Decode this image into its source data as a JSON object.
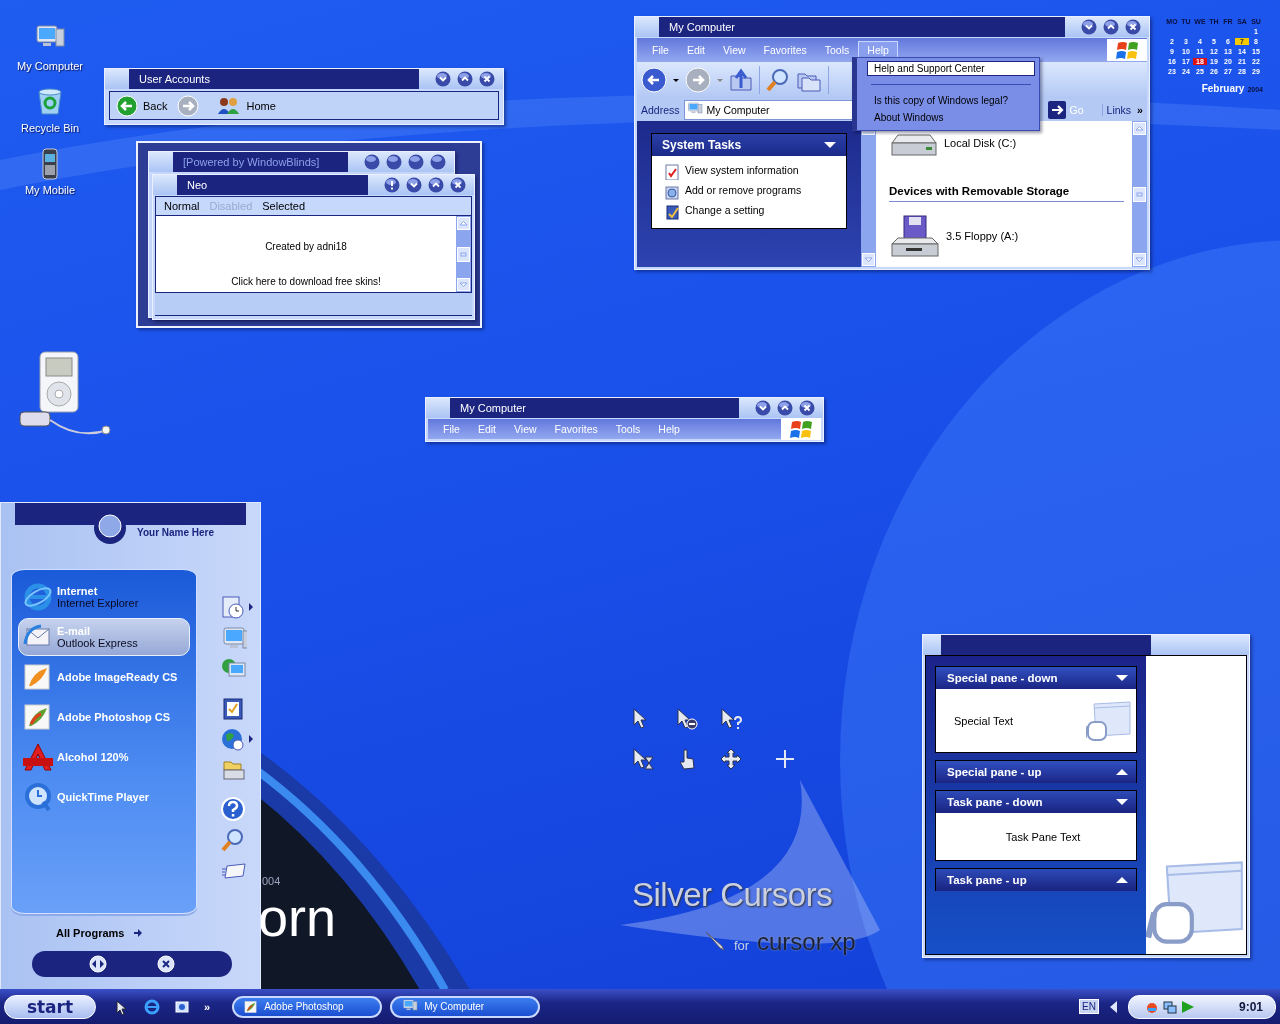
{
  "desktop_icons": [
    {
      "label": "My Computer",
      "kind": "computer"
    },
    {
      "label": "Recycle Bin",
      "kind": "recycle"
    },
    {
      "label": "My Mobile",
      "kind": "phone"
    }
  ],
  "user_accounts": {
    "title": "User Accounts",
    "back": "Back",
    "home": "Home"
  },
  "neo": {
    "back_title": "[Powered by WindowBlinds]",
    "title": "Neo",
    "menu": [
      {
        "label": "Normal",
        "disabled": false
      },
      {
        "label": "Disabled",
        "disabled": true
      },
      {
        "label": "Selected",
        "disabled": false
      }
    ],
    "text": "Created by adni18",
    "link": "Click here to download free skins!"
  },
  "explorer": {
    "title": "My Computer",
    "menu": [
      {
        "label": "File",
        "selected": false
      },
      {
        "label": "Edit",
        "selected": false
      },
      {
        "label": "View",
        "selected": false
      },
      {
        "label": "Favorites",
        "selected": false
      },
      {
        "label": "Tools",
        "selected": false
      },
      {
        "label": "Help",
        "selected": true
      }
    ],
    "address_label": "Address",
    "address": "My Computer",
    "go": "Go",
    "links": "Links",
    "more": "»",
    "tasks_title": "System Tasks",
    "tasks": [
      {
        "label": "View system information",
        "kind": "info"
      },
      {
        "label": "Add or remove programs",
        "kind": "programs"
      },
      {
        "label": "Change a setting",
        "kind": "setting"
      }
    ],
    "drives": [
      {
        "name": "Local Disk (C:)",
        "kind": "disk"
      }
    ],
    "group": "Devices with Removable Storage",
    "removable": [
      {
        "name": "3.5 Floppy (A:)",
        "kind": "floppy"
      }
    ],
    "help_menu": [
      {
        "label": "Help and Support Center",
        "selected": true
      },
      {
        "label": "Is this copy of Windows legal?",
        "selected": false
      },
      {
        "label": "About Windows",
        "selected": false
      }
    ]
  },
  "calendar": {
    "weekdays": [
      "MO",
      "TU",
      "WE",
      "TH",
      "FR",
      "SA",
      "SU"
    ],
    "weeks": [
      [
        {
          "day": "1",
          "selected": false,
          "today": false
        }
      ],
      [
        {
          "day": "2",
          "selected": false,
          "today": false
        },
        {
          "day": "3",
          "selected": false,
          "today": false
        },
        {
          "day": "4",
          "selected": false,
          "today": false
        },
        {
          "day": "5",
          "selected": false,
          "today": false
        },
        {
          "day": "6",
          "selected": false,
          "today": false
        },
        {
          "day": "7",
          "selected": true,
          "today": false
        },
        {
          "day": "8",
          "selected": false,
          "today": false
        }
      ],
      [
        {
          "day": "9",
          "selected": false,
          "today": false
        },
        {
          "day": "10",
          "selected": false,
          "today": false
        },
        {
          "day": "11",
          "selected": false,
          "today": false
        },
        {
          "day": "12",
          "selected": false,
          "today": false
        },
        {
          "day": "13",
          "selected": false,
          "today": false
        },
        {
          "day": "14",
          "selected": false,
          "today": false
        },
        {
          "day": "15",
          "selected": false,
          "today": false
        }
      ],
      [
        {
          "day": "16",
          "selected": false,
          "today": false
        },
        {
          "day": "17",
          "selected": false,
          "today": false
        },
        {
          "day": "18",
          "selected": false,
          "today": true
        },
        {
          "day": "19",
          "selected": false,
          "today": false
        },
        {
          "day": "20",
          "selected": false,
          "today": false
        },
        {
          "day": "21",
          "selected": false,
          "today": false
        },
        {
          "day": "22",
          "selected": false,
          "today": false
        }
      ],
      [
        {
          "day": "23",
          "selected": false,
          "today": false
        },
        {
          "day": "24",
          "selected": false,
          "today": false
        },
        {
          "day": "25",
          "selected": false,
          "today": false
        },
        {
          "day": "26",
          "selected": false,
          "today": false
        },
        {
          "day": "27",
          "selected": false,
          "today": false
        },
        {
          "day": "28",
          "selected": false,
          "today": false
        },
        {
          "day": "29",
          "selected": false,
          "today": false
        }
      ]
    ],
    "month": "February",
    "year": "2004"
  },
  "small_explorer": {
    "title": "My Computer",
    "menu": [
      "File",
      "Edit",
      "View",
      "Favorites",
      "Tools",
      "Help"
    ]
  },
  "wallpaper": {
    "year_fragment": "004",
    "word_fragment": "orn",
    "headline": "Silver Cursors",
    "tag_small": "for",
    "tag": "cursor xp"
  },
  "start_menu": {
    "user": "Your Name Here",
    "programs": [
      {
        "title": "Internet",
        "subtitle": "Internet Explorer",
        "kind": "ie",
        "selected": false
      },
      {
        "title": "E-mail",
        "subtitle": "Outlook Express",
        "kind": "mail",
        "selected": true
      },
      {
        "title": "Adobe ImageReady CS",
        "kind": "imageready",
        "selected": false
      },
      {
        "title": "Adobe Photoshop CS",
        "kind": "photoshop",
        "selected": false
      },
      {
        "title": "Alcohol 120%",
        "kind": "alcohol",
        "selected": false
      },
      {
        "title": "QuickTime Player",
        "kind": "quicktime",
        "selected": false
      }
    ],
    "places": [
      {
        "kind": "recent",
        "submenu": true
      },
      {
        "kind": "computer",
        "submenu": false
      },
      {
        "kind": "network",
        "submenu": false
      },
      {
        "kind": "control",
        "submenu": false
      },
      {
        "kind": "web",
        "submenu": true
      },
      {
        "kind": "printer",
        "submenu": false
      },
      {
        "kind": "help",
        "submenu": false
      },
      {
        "kind": "search",
        "submenu": false
      },
      {
        "kind": "run",
        "submenu": false
      }
    ],
    "all_programs": "All Programs"
  },
  "task_pane": {
    "panes": [
      {
        "title": "Special pane - down",
        "kind": "special",
        "expanded": true,
        "body": "Special Text"
      },
      {
        "title": "Special pane - up",
        "kind": "special",
        "expanded": false
      },
      {
        "title": "Task pane - down",
        "kind": "task",
        "expanded": true,
        "body": "Task Pane Text"
      },
      {
        "title": "Task pane - up",
        "kind": "task",
        "expanded": false
      }
    ]
  },
  "taskbar": {
    "start": "start",
    "more": "»",
    "tasks": [
      {
        "label": "Adobe Photoshop",
        "kind": "photoshop"
      },
      {
        "label": "My Computer",
        "kind": "computer"
      }
    ],
    "language": "EN",
    "clock": "9:01"
  }
}
